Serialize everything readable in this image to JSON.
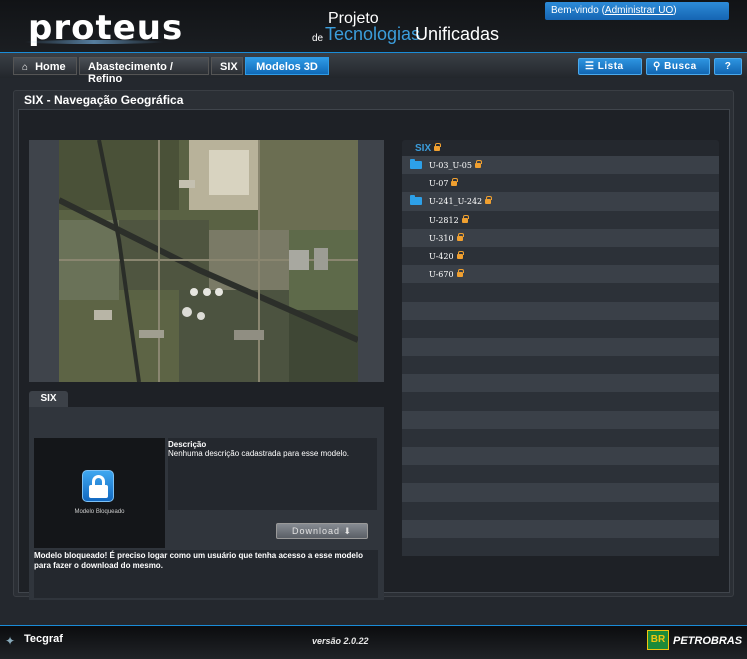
{
  "header": {
    "logo": "proteus",
    "project_line1": "Projeto",
    "project_line2": "de",
    "project_line3": "Tecnologias",
    "project_line4": "Unificadas",
    "welcome_prefix": "Bem-vindo (",
    "welcome_link": "Administrar UO",
    "welcome_suffix": ")"
  },
  "breadcrumbs": [
    {
      "label": "Home"
    },
    {
      "label": "Abastecimento / Refino"
    },
    {
      "label": "SIX"
    },
    {
      "label": "Modelos 3D"
    }
  ],
  "nav_buttons": {
    "list": "Lista",
    "search": "Busca",
    "help": "?"
  },
  "panel": {
    "title": "SIX - Navegação Geográfica"
  },
  "info": {
    "tab": "SIX",
    "lock_caption": "Modelo Bloqueado",
    "desc_title": "Descrição",
    "desc_text": "Nenhuma descrição cadastrada para esse modelo.",
    "download": "Download",
    "warning": "Modelo bloqueado! É preciso logar como um usuário que tenha acesso a esse modelo para fazer o download do mesmo."
  },
  "list": {
    "header": "SIX",
    "items": [
      {
        "label": "U-03_U-05",
        "folder": true
      },
      {
        "label": "U-07",
        "folder": false
      },
      {
        "label": "U-241_U-242",
        "folder": true
      },
      {
        "label": "U-2812",
        "folder": false
      },
      {
        "label": "U-310",
        "folder": false
      },
      {
        "label": "U-420",
        "folder": false
      },
      {
        "label": "U-670",
        "folder": false
      }
    ]
  },
  "footer": {
    "tecgraf": "Tecgraf",
    "version": "versão 2.0.22",
    "petrobras": "PETROBRAS",
    "br": "BR"
  },
  "colors": {
    "accent": "#2d94e0",
    "lock": "#f0a030"
  }
}
